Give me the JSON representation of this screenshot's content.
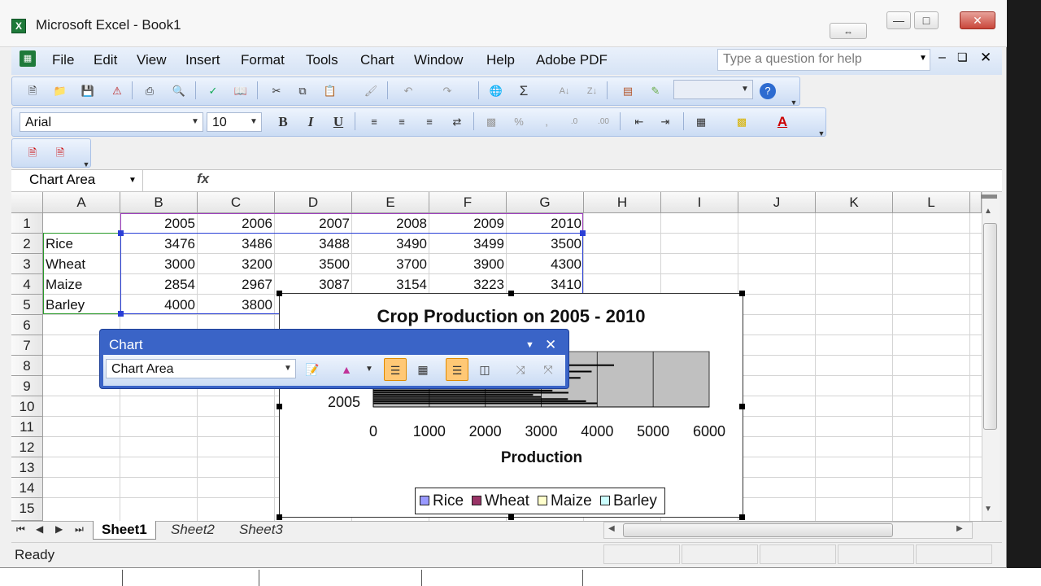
{
  "window": {
    "title": "Microsoft Excel - Book1",
    "app_icon": "X"
  },
  "menu": [
    "File",
    "Edit",
    "View",
    "Insert",
    "Format",
    "Tools",
    "Chart",
    "Window",
    "Help",
    "Adobe PDF"
  ],
  "help_box": {
    "placeholder": "Type a question for help"
  },
  "formatting": {
    "font": "Arial",
    "size": "10"
  },
  "namebox": {
    "value": "Chart Area"
  },
  "formula_icon": "fx",
  "columns": [
    "A",
    "B",
    "C",
    "D",
    "E",
    "F",
    "G",
    "H",
    "I",
    "J",
    "K",
    "L"
  ],
  "rows": [
    "1",
    "2",
    "3",
    "4",
    "5",
    "6",
    "7",
    "8",
    "9",
    "10",
    "11",
    "12",
    "13",
    "14",
    "15"
  ],
  "cells": {
    "years": [
      "2005",
      "2006",
      "2007",
      "2008",
      "2009",
      "2010"
    ],
    "data": [
      {
        "label": "Rice",
        "values": [
          "3476",
          "3486",
          "3488",
          "3490",
          "3499",
          "3500"
        ]
      },
      {
        "label": "Wheat",
        "values": [
          "3000",
          "3200",
          "3500",
          "3700",
          "3900",
          "4300"
        ]
      },
      {
        "label": "Maize",
        "values": [
          "2854",
          "2967",
          "3087",
          "3154",
          "3223",
          "3410"
        ]
      },
      {
        "label": "Barley",
        "values": [
          "4000",
          "3800"
        ]
      }
    ]
  },
  "sheets": {
    "tabs": [
      "Sheet1",
      "Sheet2",
      "Sheet3"
    ],
    "active": "Sheet1"
  },
  "status": {
    "text": "Ready"
  },
  "chart_toolbar": {
    "title": "Chart",
    "object": "Chart Area"
  },
  "chart_data": {
    "type": "bar",
    "orientation": "horizontal",
    "title": "Crop Production on 2005 - 2010",
    "xlabel": "Production",
    "ylabel": "",
    "xlim": [
      0,
      6000
    ],
    "x_ticks": [
      "0",
      "1000",
      "2000",
      "3000",
      "4000",
      "5000",
      "6000"
    ],
    "visible_categories": [
      "2005"
    ],
    "series": [
      {
        "name": "Rice",
        "color": "#9999ff"
      },
      {
        "name": "Wheat",
        "color": "#993366"
      },
      {
        "name": "Maize",
        "color": "#ffffcc"
      },
      {
        "name": "Barley",
        "color": "#ccffff"
      }
    ],
    "plot_area_color": "#c0c0c0",
    "legend": "bottom"
  }
}
